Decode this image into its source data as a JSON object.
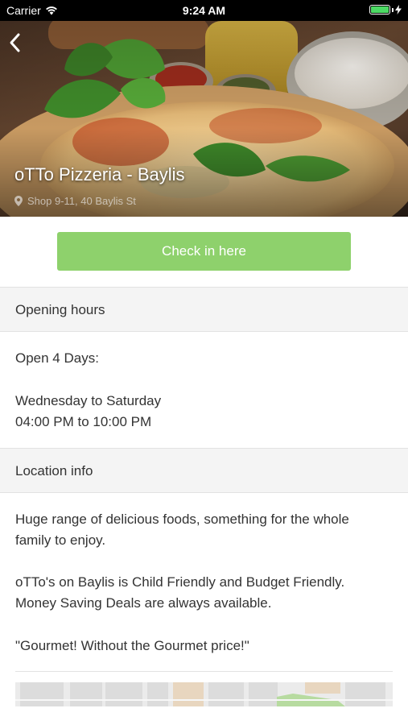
{
  "status_bar": {
    "carrier": "Carrier",
    "time": "9:24 AM",
    "battery_level": 1.0,
    "battery_color": "#4cd964"
  },
  "hero": {
    "back_icon": "chevron-left-icon",
    "title": "oTTo Pizzeria - Baylis",
    "address_icon": "location-pin-icon",
    "address": "Shop 9-11, 40 Baylis St"
  },
  "checkin": {
    "label": "Check in here",
    "color": "#8ed16c"
  },
  "opening_hours": {
    "header": "Opening hours",
    "line1": "Open 4 Days:",
    "line2": "Wednesday to Saturday",
    "line3": "04:00 PM to 10:00 PM"
  },
  "location_info": {
    "header": "Location info",
    "para1_line1": "Huge range of delicious foods, something for the whole",
    "para1_line2": "family to enjoy.",
    "para2_line1": "oTTo's on Baylis is Child Friendly and Budget Friendly.",
    "para2_line2": "Money Saving Deals are always available.",
    "quote": "\"Gourmet! Without the Gourmet price!\""
  }
}
